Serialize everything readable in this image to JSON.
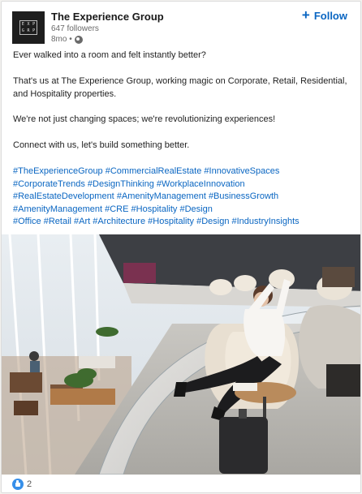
{
  "post": {
    "company": "The Experience Group",
    "followers": "647 followers",
    "time": "8mo •",
    "follow_label": "Follow",
    "logo_letters": [
      "E",
      "X",
      "P",
      "G",
      "R",
      "P"
    ],
    "paragraphs": [
      "Ever walked into a room and felt instantly better?",
      "That's us at The Experience Group, working magic on Corporate, Retail, Residential, and Hospitality properties.",
      "We're not just changing spaces; we're revolutionizing experiences!",
      "Connect with us, let's build something better."
    ],
    "hashtag_lines": [
      [
        "#TheExperienceGroup",
        "#CommercialRealEstate",
        "#InnovativeSpaces"
      ],
      [
        "#CorporateTrends",
        "#DesignThinking",
        "#WorkplaceInnovation"
      ],
      [
        "#RealEstateDevelopment",
        "#AmenityManagement",
        "#BusinessGrowth"
      ],
      [
        "#AmenityManagement",
        "#CRE",
        "#Hospitality",
        "#Design"
      ],
      [
        "#Office",
        "#Retail",
        "#Art",
        "#Architecture",
        "#Hospitality",
        "#Design",
        "#IndustryInsights"
      ]
    ],
    "reaction_count": "2"
  },
  "icons": {
    "follow": "plus-icon",
    "visibility": "globe-icon",
    "reaction": "like-icon"
  },
  "colors": {
    "accent": "#0a66c2",
    "muted": "#6a6a6a",
    "like": "#378fe9"
  }
}
